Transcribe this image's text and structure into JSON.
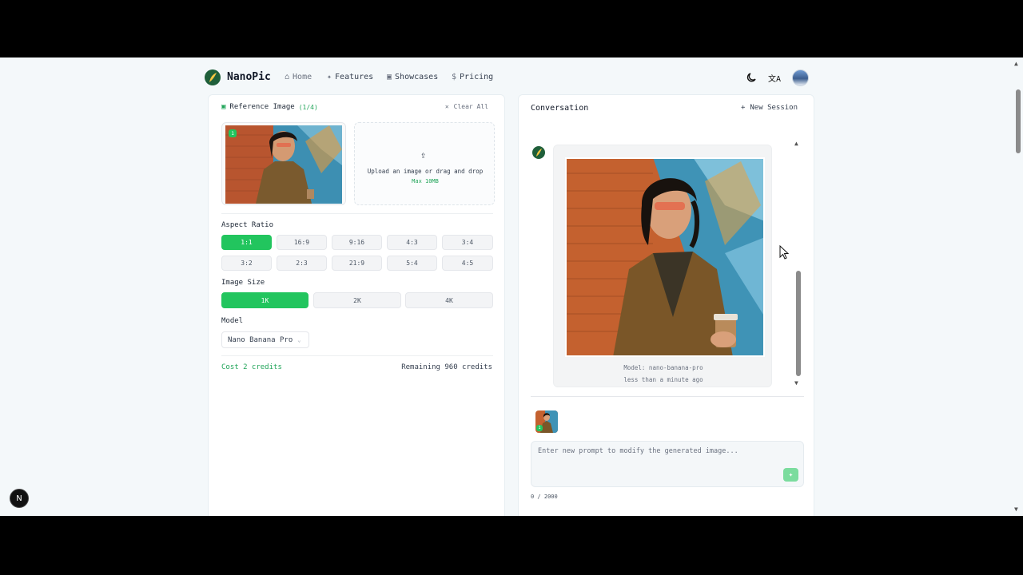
{
  "app": {
    "brand": "NanoPic"
  },
  "nav": {
    "home": "Home",
    "features": "Features",
    "showcases": "Showcases",
    "pricing": "Pricing"
  },
  "header_icons": [
    "moon-icon",
    "translate-icon",
    "user-avatar"
  ],
  "left": {
    "reference_title": "Reference Image",
    "reference_count": "(1/4)",
    "clear_all": "Clear All",
    "thumb_badge": "1",
    "upload_text": "Upload an image or drag and drop",
    "upload_max": "Max 10MB",
    "aspect_ratio_label": "Aspect Ratio",
    "aspect_ratios": [
      "1:1",
      "16:9",
      "9:16",
      "4:3",
      "3:4",
      "3:2",
      "2:3",
      "21:9",
      "5:4",
      "4:5"
    ],
    "aspect_selected": "1:1",
    "image_size_label": "Image Size",
    "image_sizes": [
      "1K",
      "2K",
      "4K"
    ],
    "image_size_selected": "1K",
    "model_label": "Model",
    "model_value": "Nano Banana Pro",
    "cost": "Cost 2 credits",
    "remaining": "Remaining 960 credits"
  },
  "right": {
    "conversation_title": "Conversation",
    "new_session": "New Session",
    "meta_model": "Model: nano-banana-pro",
    "meta_time": "less than a minute ago",
    "attach_badge": "1",
    "prompt_placeholder": "Enter new prompt to modify the generated image...",
    "prompt_value": "",
    "char_count": "0 / 2000"
  },
  "colors": {
    "accent": "#22c55e",
    "accent_text": "#22a55a",
    "brand_dark": "#1f5f3a"
  },
  "dev_badge": "N"
}
